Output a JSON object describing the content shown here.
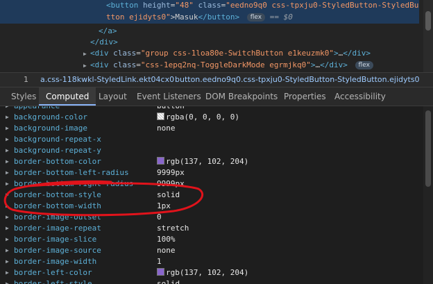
{
  "elements": {
    "line1": {
      "open": "<button",
      "attr1_name": "height",
      "attr1_val": "\"48\"",
      "attr2_name": "class",
      "attr2_val": "\"eedno9q0 css-tpxju0-StyledButton-StyledBu"
    },
    "line2": {
      "val_tail": "tton ejidyts0\"",
      "text": ">Masuk",
      "close": "</button>",
      "badge": "flex",
      "dollar": "== $0"
    },
    "line3": "</a>",
    "line4": "</div>",
    "line5": {
      "open": "<div",
      "attr_name": "class",
      "attr_val": "\"group css-1loa80e-SwitchButton e1keuzmk0\"",
      "mid": ">",
      "ellipsis": "…",
      "close": "</div>"
    },
    "line6": {
      "open": "<div",
      "attr_name": "class",
      "attr_val": "\"css-1epq2nq-ToggleDarkMode egrmjkq0\"",
      "mid": ">",
      "ellipsis": "…",
      "close": "</div>",
      "badge": "flex"
    }
  },
  "breadcrumb": {
    "items": [
      "1",
      "a.css-118kwkl-StyledLink.ekt04cx0",
      "button.eedno9q0.css-tpxju0-StyledButton-StyledButton.ejidyts0"
    ]
  },
  "tabs": [
    "Styles",
    "Computed",
    "Layout",
    "Event Listeners",
    "DOM Breakpoints",
    "Properties",
    "Accessibility"
  ],
  "active_tab": "Computed",
  "computed": {
    "rows": [
      {
        "prop": "appearance",
        "value": "button",
        "swatch": ""
      },
      {
        "prop": "background-color",
        "value": "rgba(0, 0, 0, 0)",
        "swatch": "rgba(0,0,0,0)"
      },
      {
        "prop": "background-image",
        "value": "none",
        "swatch": ""
      },
      {
        "prop": "background-repeat-x",
        "value": "",
        "swatch": ""
      },
      {
        "prop": "background-repeat-y",
        "value": "",
        "swatch": ""
      },
      {
        "prop": "border-bottom-color",
        "value": "rgb(137, 102, 204)",
        "swatch": "#8966cc"
      },
      {
        "prop": "border-bottom-left-radius",
        "value": "9999px",
        "swatch": ""
      },
      {
        "prop": "border-bottom-right-radius",
        "value": "9999px",
        "swatch": ""
      },
      {
        "prop": "border-bottom-style",
        "value": "solid",
        "swatch": ""
      },
      {
        "prop": "border-bottom-width",
        "value": "1px",
        "swatch": ""
      },
      {
        "prop": "border-image-outset",
        "value": "0",
        "swatch": ""
      },
      {
        "prop": "border-image-repeat",
        "value": "stretch",
        "swatch": ""
      },
      {
        "prop": "border-image-slice",
        "value": "100%",
        "swatch": ""
      },
      {
        "prop": "border-image-source",
        "value": "none",
        "swatch": ""
      },
      {
        "prop": "border-image-width",
        "value": "1",
        "swatch": ""
      },
      {
        "prop": "border-left-color",
        "value": "rgb(137, 102, 204)",
        "swatch": "#8966cc"
      },
      {
        "prop": "border-left-style",
        "value": "solid",
        "swatch": ""
      }
    ]
  },
  "colors": {
    "annotation": "#e0131b",
    "accent": "#8ab4f8"
  }
}
